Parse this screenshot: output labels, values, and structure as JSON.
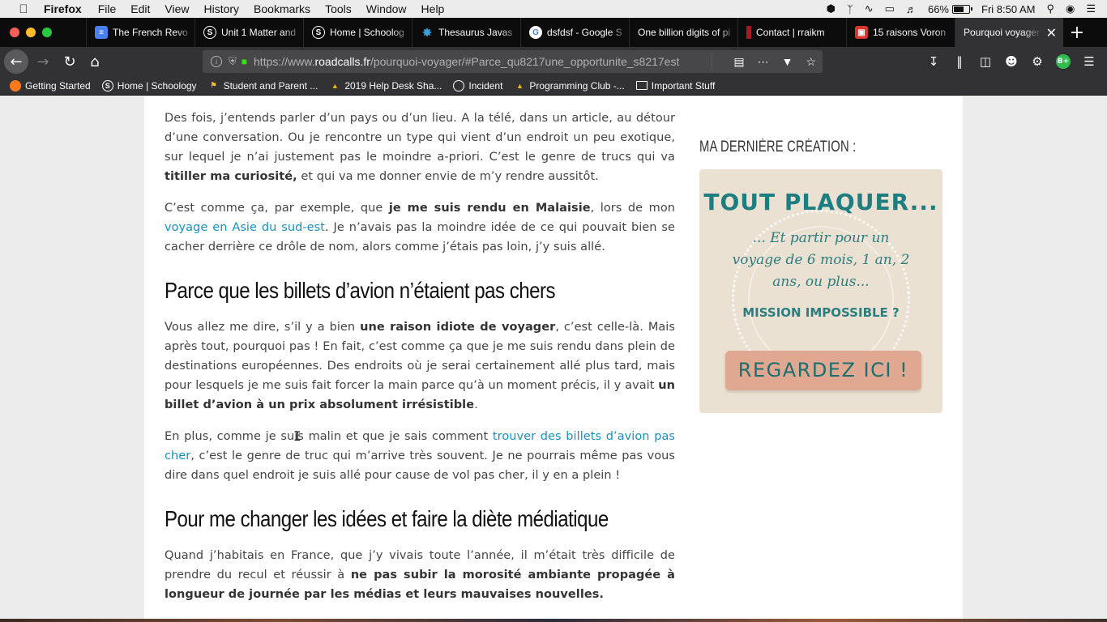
{
  "menubar": {
    "app": "Firefox",
    "items": [
      "File",
      "Edit",
      "View",
      "History",
      "Bookmarks",
      "Tools",
      "Window",
      "Help"
    ],
    "battery": "66%",
    "clock": "Fri 8:50 AM"
  },
  "tabs": [
    {
      "label": "The French Revo",
      "icon": "docs-icon",
      "color": "#4a7ff0"
    },
    {
      "label": "Unit 1 Matter and",
      "icon": "schoology-icon",
      "color": "#0c0c0d"
    },
    {
      "label": "Home | Schoolog",
      "icon": "schoology-icon",
      "color": "#0c0c0d"
    },
    {
      "label": "Thesaurus Javas",
      "icon": "puzzle-icon",
      "color": "#39a2dd"
    },
    {
      "label": "dsfdsf - Google S",
      "icon": "google-icon",
      "color": "#ffffff"
    },
    {
      "label": "One billion digits of pi",
      "icon": "",
      "color": ""
    },
    {
      "label": "Contact | rraikm",
      "icon": "bar-icon",
      "color": "#a41b21"
    },
    {
      "label": "15 raisons Voron",
      "icon": "roadcalls-icon",
      "color": "#d8352e"
    },
    {
      "label": "Pourquoi voyager",
      "icon": "",
      "color": "",
      "active": true
    }
  ],
  "url": {
    "prefix": "https://www.",
    "domain": "roadcalls.fr",
    "path": "/pourquoi-voyager/#Parce_qu8217une_opportunite_s8217est"
  },
  "bookmarks": [
    {
      "label": "Getting Started",
      "icon": "firefox-icon"
    },
    {
      "label": "Home | Schoology",
      "icon": "schoology-icon"
    },
    {
      "label": "Student and Parent ...",
      "icon": "flag-icon"
    },
    {
      "label": "2019 Help Desk Sha...",
      "icon": "drive-icon"
    },
    {
      "label": "Incident",
      "icon": "globe-icon"
    },
    {
      "label": "Programming Club -...",
      "icon": "drive-icon"
    },
    {
      "label": "Important Stuff",
      "icon": "folder-icon"
    }
  ],
  "article": {
    "p1_a": "Des fois, j’entends parler d’un pays ou d’un lieu. A la télé, dans un article, au détour d’une conversation. Ou je rencontre un type qui vient d’un endroit un peu exotique, sur lequel je n’ai justement pas le moindre a-priori. C’est le genre de trucs qui va ",
    "p1_b": "titiller ma curiosité,",
    "p1_c": " et qui va me donner envie de m’y rendre aussitôt.",
    "p2_a": "C’est comme ça, par exemple, que ",
    "p2_b": "je me suis rendu en Malaisie",
    "p2_c": ", lors de mon ",
    "p2_link": "voyage en Asie du sud-est",
    "p2_d": ". Je n’avais pas la moindre idée de ce qui pouvait bien se cacher der­rière ce drôle de nom, alors comme j’étais pas loin, j’y suis allé.",
    "h2_1": "Parce que les billets d’avion n’étaient pas chers",
    "p3_a": "Vous allez me dire, s’il y a bien ",
    "p3_b": "une raison idiote de voyager",
    "p3_c": ", c’est celle-là. Mais après tout, pourquoi pas ! En fait, c’est comme ça que je me suis rendu dans plein de destinations européennes. Des endroits où je serai certainement allé plus tard, mais pour lesquels je me suis fait forcer la main parce qu’à un moment précis, il y avait ",
    "p3_d": "un billet d’avion à un prix absolument irrésistible",
    "p3_e": ".",
    "p4_a": "En plus, comme je suis malin et que je sais comment ",
    "p4_link": "trouver des billets d’avion pas cher",
    "p4_b": ", c’est le genre de truc qui m’arrive très souvent. Je ne pourrais même pas vous dire dans quel endroit je suis allé pour cause de vol pas cher, il y en a plein !",
    "h2_2": "Pour me changer les idées et faire la diète médiatique",
    "p5_a": "Quand j’habitais en France, que j’y vivais toute l’année, il m’était très difficile de prendre du recul et réussir à ",
    "p5_b": "ne pas subir la morosité ambiante propagée à longueur de journée par les médias et leurs mauvaises nouvelles."
  },
  "sidebar": {
    "title": "MA DERNIÈRE CRÉATION :",
    "promo_title": "TOUT PLAQUER...",
    "promo_sub": "... Et partir pour un voyage de 6 mois, 1 an, 2 ans, ou plus...",
    "promo_mission": "MISSION IMPOSSIBLE ?",
    "promo_button": "REGARDEZ ICI !"
  }
}
